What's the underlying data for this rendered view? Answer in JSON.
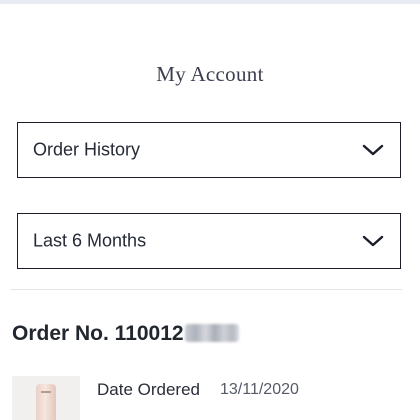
{
  "account": {
    "title": "My Account"
  },
  "filters": {
    "section": {
      "selected": "Order History",
      "icon": "chevron-down-icon"
    },
    "range": {
      "selected": "Last 6 Months",
      "icon": "chevron-down-icon"
    }
  },
  "order": {
    "number_label": "Order No. 110012",
    "date_label": "Date Ordered",
    "date_value": "13/11/2020"
  },
  "colors": {
    "text": "#1f2430",
    "border": "#1b1e29",
    "divider": "#e4e6ea",
    "top_strip": "#e8ebf2"
  }
}
